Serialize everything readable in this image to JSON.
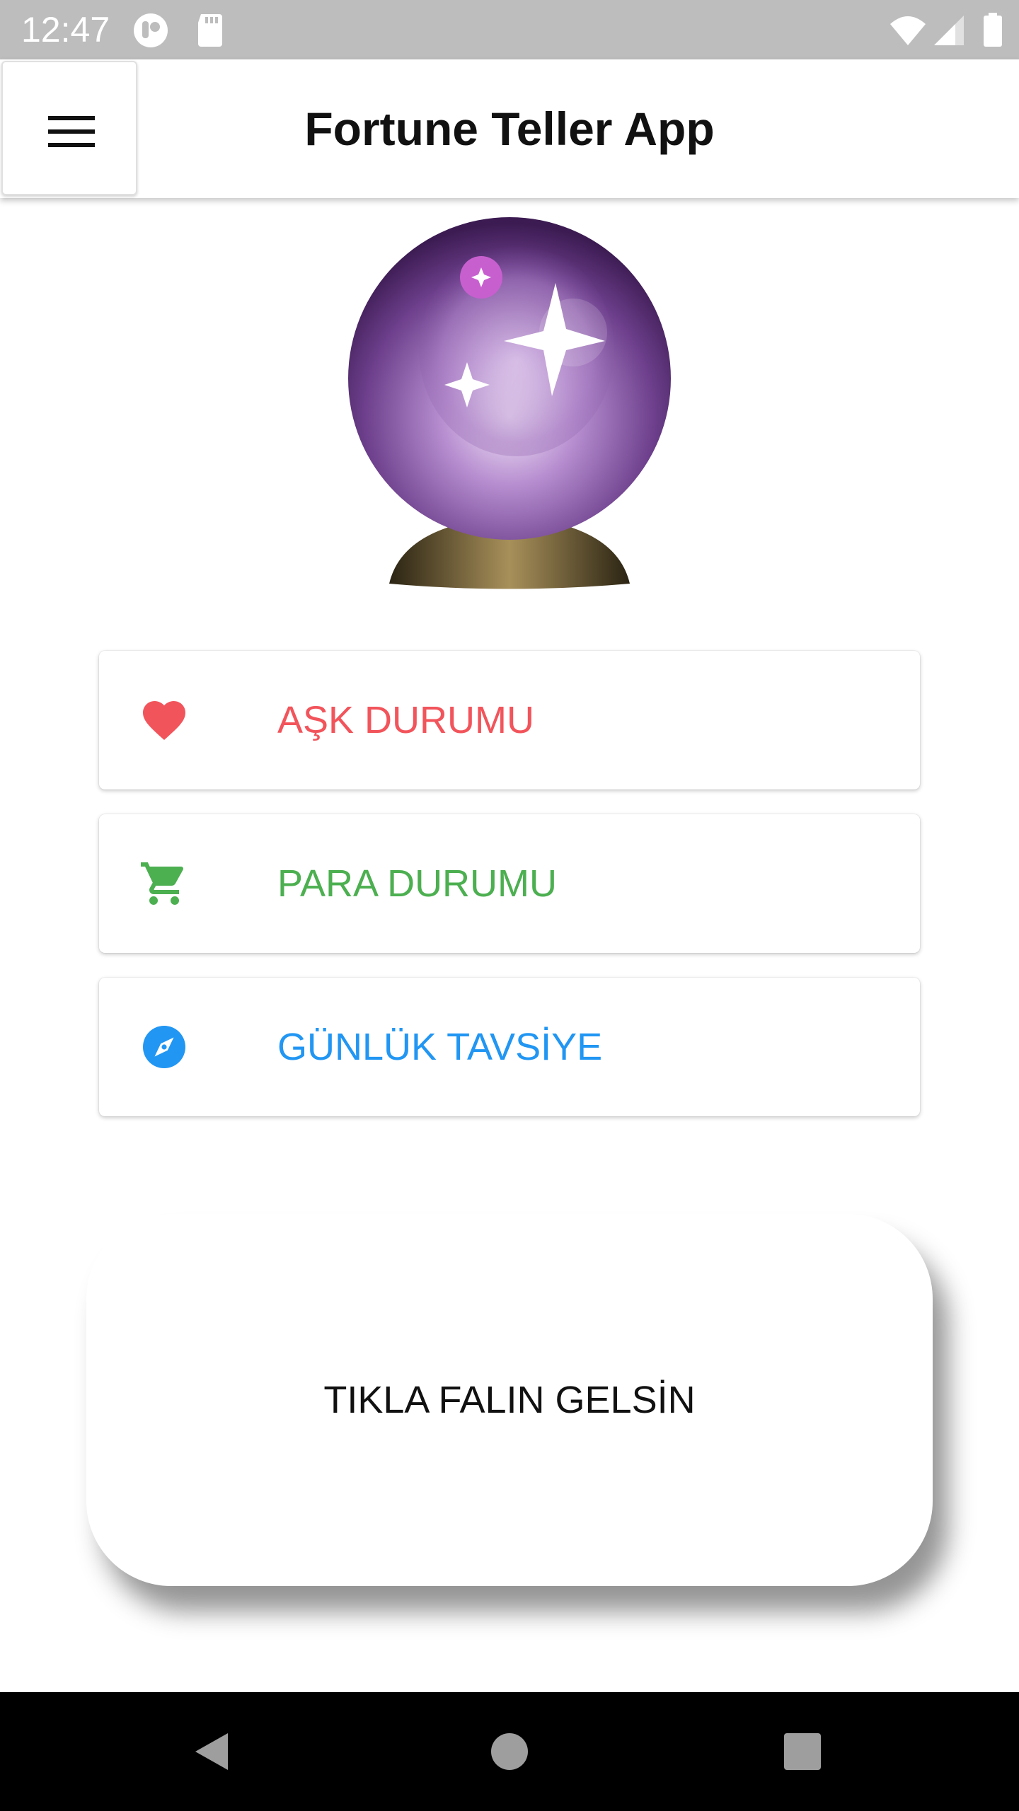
{
  "status_bar": {
    "time": "12:47",
    "icons": [
      "notification-app-icon",
      "sd-card-icon",
      "wifi-icon",
      "cellular-signal-icon",
      "battery-icon"
    ]
  },
  "app_bar": {
    "title": "Fortune Teller App",
    "menu_icon": "hamburger-menu-icon"
  },
  "hero": {
    "icon": "crystal-ball-icon"
  },
  "options": [
    {
      "label": "AŞK DURUMU",
      "icon": "heart-icon",
      "color": "#f2545b"
    },
    {
      "label": "PARA DURUMU",
      "icon": "shopping-cart-icon",
      "color": "#4caf50"
    },
    {
      "label": "GÜNLÜK TAVSİYE",
      "icon": "compass-icon",
      "color": "#2196f3"
    }
  ],
  "action": {
    "label": "TIKLA FALIN GELSİN"
  },
  "nav_bar": {
    "buttons": [
      "back-icon",
      "home-icon",
      "recents-icon"
    ]
  }
}
